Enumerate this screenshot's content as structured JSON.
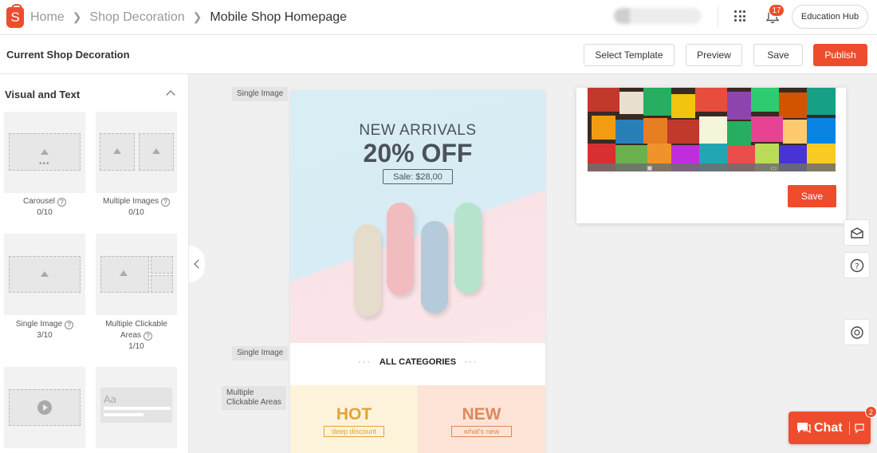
{
  "app": {
    "logo_glyph": "S",
    "brand_color": "#ee4d2d"
  },
  "breadcrumb": [
    "Home",
    "Shop Decoration",
    "Mobile Shop Homepage"
  ],
  "header": {
    "notification_count": "17",
    "education_hub_label": "Education Hub"
  },
  "toolbar": {
    "title": "Current Shop Decoration",
    "select_template_label": "Select Template",
    "preview_label": "Preview",
    "save_label": "Save",
    "publish_label": "Publish"
  },
  "sidebar": {
    "section_title": "Visual and Text",
    "components": [
      {
        "name": "Carousel",
        "count": "0/10"
      },
      {
        "name": "Multiple Images",
        "count": "0/10"
      },
      {
        "name": "Single Image",
        "count": "3/10"
      },
      {
        "name": "Multiple Clickable Areas",
        "name_line1": "Multiple Clickable",
        "name_line2": "Areas",
        "count": "1/10"
      },
      {
        "name": "",
        "count": ""
      },
      {
        "name": "",
        "count": "",
        "text_placeholder": "Aa"
      }
    ]
  },
  "canvas": {
    "labels": [
      "Single Image",
      "Single Image",
      "Multiple Clickable Areas"
    ],
    "label_multi_line1": "Multiple",
    "label_multi_line2": "Clickable Areas",
    "banner": {
      "headline": "NEW ARRIVALS",
      "discount": "20% OFF",
      "sale_price": "Sale: $28,00",
      "pill_colors": [
        "#e6dccb",
        "#f1bcc0",
        "#b5cbdc",
        "#b6e3cc"
      ]
    },
    "categories_label": "ALL CATEGORIES",
    "categories_dots": "···",
    "clickable_areas": [
      {
        "title": "HOT",
        "subtitle": "deep discount",
        "bg": "#fdf3da",
        "color": "#e2a33a"
      },
      {
        "title": "NEW",
        "subtitle": "what's new",
        "bg": "#fde4d6",
        "color": "#e0875b"
      }
    ]
  },
  "preview_card": {
    "save_label": "Save"
  },
  "right_rail": {
    "icons": [
      "mail-icon",
      "help-icon",
      "support-icon"
    ]
  },
  "chat": {
    "label": "Chat",
    "badge": "2"
  }
}
